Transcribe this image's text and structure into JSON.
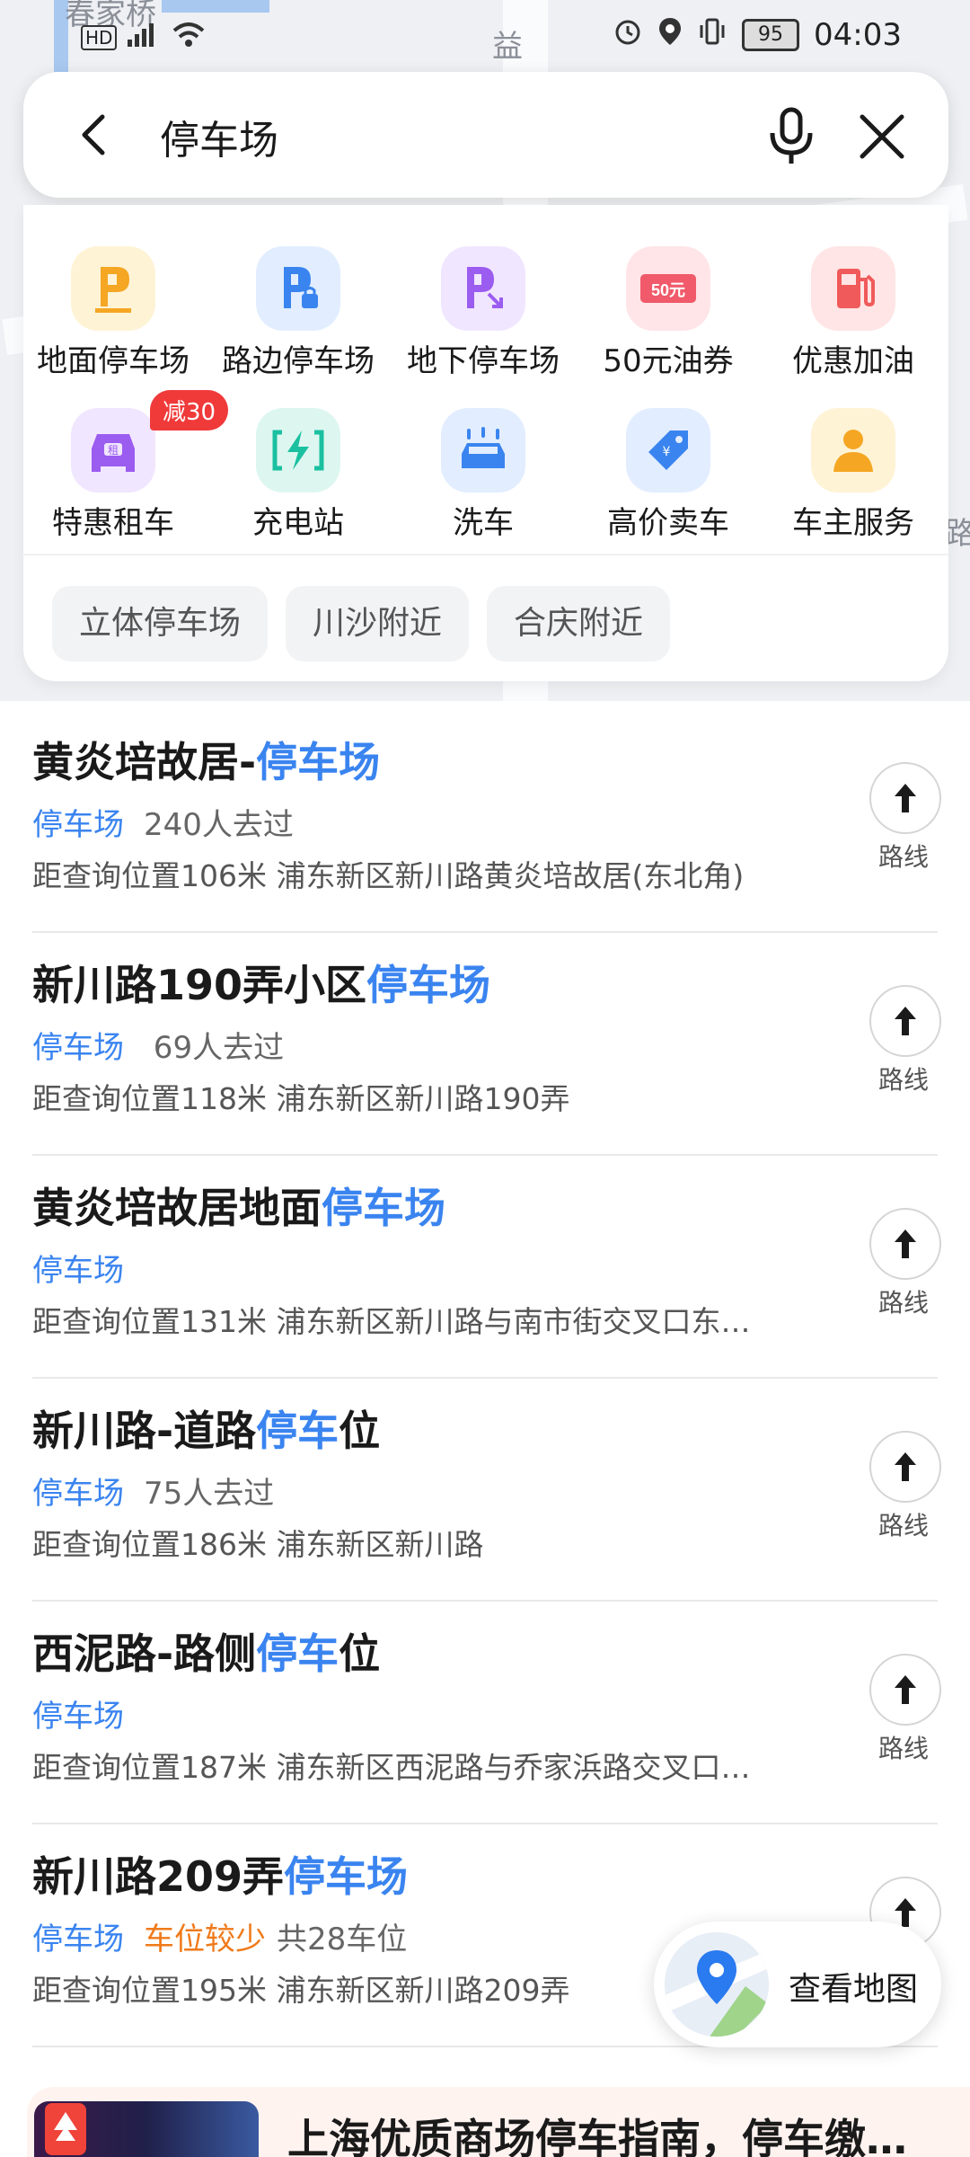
{
  "status_bar": {
    "network": "HD",
    "signal": "5G",
    "battery": "95",
    "time": "04:03"
  },
  "map_labels": [
    "春家桥",
    "益",
    "路",
    "路"
  ],
  "search": {
    "value": "停车场",
    "back_icon": "back-arrow-icon",
    "mic_icon": "mic-icon",
    "close_icon": "close-icon"
  },
  "categories": [
    {
      "label": "地面停车场",
      "icon": "parking-p-icon",
      "color": "#f5a623"
    },
    {
      "label": "路边停车场",
      "icon": "roadside-parking-icon",
      "color": "#3a84f0"
    },
    {
      "label": "地下停车场",
      "icon": "underground-parking-icon",
      "color": "#9b5cf0"
    },
    {
      "label": "50元油券",
      "icon": "fuel-coupon-icon",
      "color": "#f05a6a"
    },
    {
      "label": "优惠加油",
      "icon": "gas-pump-icon",
      "color": "#f05a5a"
    },
    {
      "label": "特惠租车",
      "icon": "rental-car-icon",
      "color": "#9b5cf0",
      "badge": "减30"
    },
    {
      "label": "充电站",
      "icon": "charging-icon",
      "color": "#1ac0a0"
    },
    {
      "label": "洗车",
      "icon": "car-wash-icon",
      "color": "#3a84f0"
    },
    {
      "label": "高价卖车",
      "icon": "price-tag-icon",
      "color": "#3a84f0"
    },
    {
      "label": "车主服务",
      "icon": "driver-service-icon",
      "color": "#f5a623"
    }
  ],
  "chips": [
    "立体停车场",
    "川沙附近",
    "合庆附近"
  ],
  "results": [
    {
      "title_pre": "黄炎培故居-",
      "title_hl": "停车场",
      "title_post": "",
      "type": "停车场",
      "warn": "",
      "visits": "240人去过",
      "addr": "距查询位置106米  浦东新区新川路黄炎培故居(东北角)"
    },
    {
      "title_pre": "新川路190弄小区",
      "title_hl": "停车场",
      "title_post": "",
      "type": "停车场",
      "warn": "",
      "visits": " 69人去过",
      "addr": "距查询位置118米  浦东新区新川路190弄"
    },
    {
      "title_pre": "黄炎培故居地面",
      "title_hl": "停车场",
      "title_post": "",
      "type": "停车场",
      "warn": "",
      "visits": "",
      "addr": "距查询位置131米  浦东新区新川路与南市街交叉口东…"
    },
    {
      "title_pre": "新川路-道路",
      "title_hl": "停车",
      "title_post": "位",
      "type": "停车场",
      "warn": "",
      "visits": "75人去过",
      "addr": "距查询位置186米  浦东新区新川路"
    },
    {
      "title_pre": "西泥路-路侧",
      "title_hl": "停车",
      "title_post": "位",
      "type": "停车场",
      "warn": "",
      "visits": "",
      "addr": "距查询位置187米  浦东新区西泥路与乔家浜路交叉口…"
    },
    {
      "title_pre": "新川路209弄",
      "title_hl": "停车场",
      "title_post": "",
      "type": "停车场",
      "warn": "车位较少",
      "visits": "共28车位",
      "addr": "距查询位置195米  浦东新区新川路209弄"
    }
  ],
  "route_label": "路线",
  "view_map": "查看地图",
  "banner_title": "上海优质商场停车指南，停车缴…"
}
